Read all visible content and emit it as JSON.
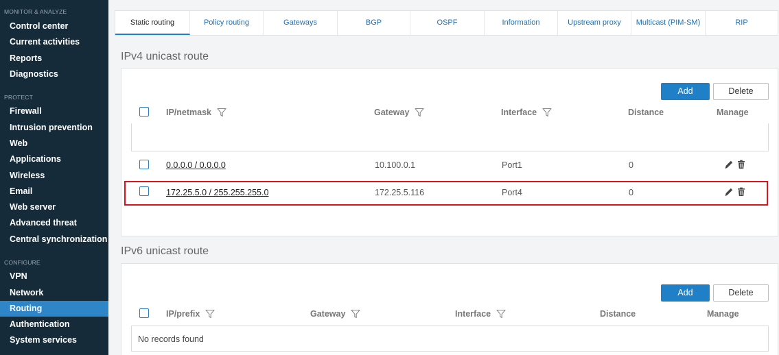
{
  "sidebar": {
    "sections": [
      {
        "label": "MONITOR & ANALYZE",
        "items": [
          "Control center",
          "Current activities",
          "Reports",
          "Diagnostics"
        ]
      },
      {
        "label": "PROTECT",
        "items": [
          "Firewall",
          "Intrusion prevention",
          "Web",
          "Applications",
          "Wireless",
          "Email",
          "Web server",
          "Advanced threat",
          "Central synchronization"
        ]
      },
      {
        "label": "CONFIGURE",
        "items": [
          "VPN",
          "Network",
          "Routing",
          "Authentication",
          "System services"
        ]
      }
    ],
    "active_item": "Routing"
  },
  "tabs": [
    "Static routing",
    "Policy routing",
    "Gateways",
    "BGP",
    "OSPF",
    "Information",
    "Upstream proxy",
    "Multicast (PIM-SM)",
    "RIP"
  ],
  "active_tab": "Static routing",
  "ipv4": {
    "title": "IPv4 unicast route",
    "add_label": "Add",
    "delete_label": "Delete",
    "columns": {
      "ip": "IP/netmask",
      "gateway": "Gateway",
      "interface": "Interface",
      "distance": "Distance",
      "manage": "Manage"
    },
    "rows": [
      {
        "ip": "0.0.0.0 / 0.0.0.0",
        "gateway": "10.100.0.1",
        "interface": "Port1",
        "distance": "0"
      },
      {
        "ip": "172.25.5.0 / 255.255.255.0",
        "gateway": "172.25.5.116",
        "interface": "Port4",
        "distance": "0"
      }
    ]
  },
  "ipv6": {
    "title": "IPv6 unicast route",
    "add_label": "Add",
    "delete_label": "Delete",
    "columns": {
      "ip": "IP/prefix",
      "gateway": "Gateway",
      "interface": "Interface",
      "distance": "Distance",
      "manage": "Manage"
    },
    "empty_text": "No records found"
  },
  "colors": {
    "accent": "#1f7fc7",
    "sidebar_bg": "#152b3a",
    "highlight": "#d9141e"
  },
  "icons": {
    "filter": "filter-icon",
    "edit": "pencil-icon",
    "delete": "trash-icon"
  }
}
